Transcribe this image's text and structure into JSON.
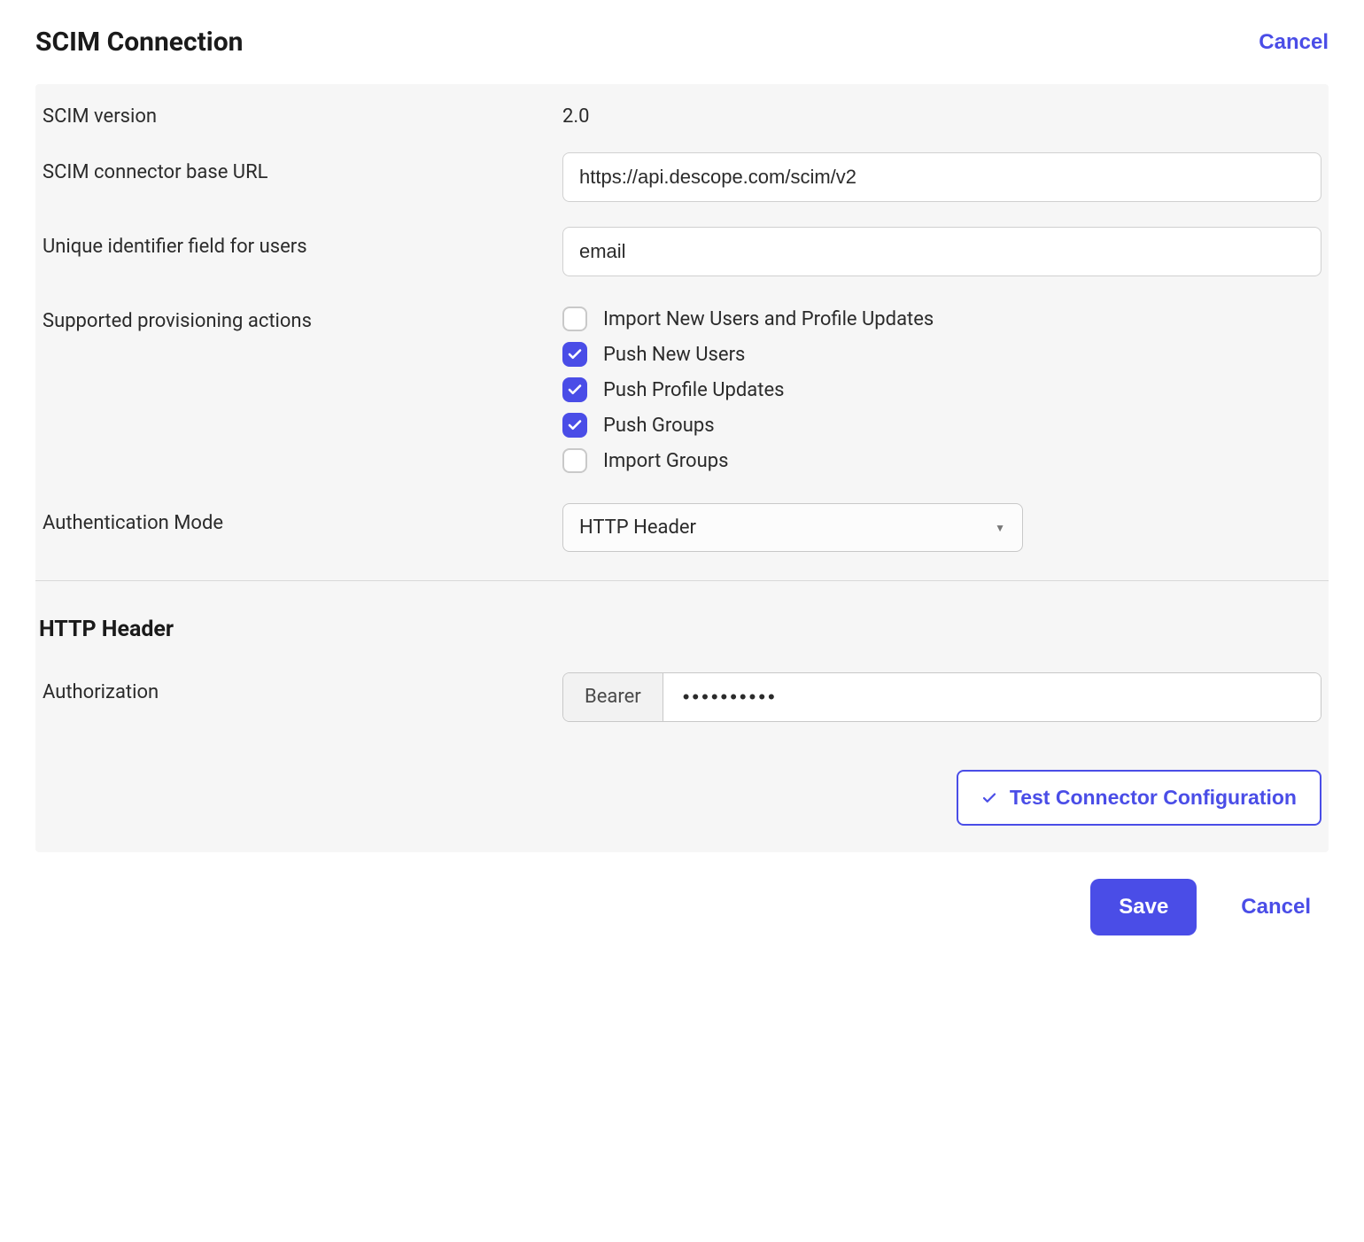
{
  "header": {
    "title": "SCIM Connection",
    "cancel": "Cancel"
  },
  "form": {
    "scim_version": {
      "label": "SCIM version",
      "value": "2.0"
    },
    "base_url": {
      "label": "SCIM connector base URL",
      "value": "https://api.descope.com/scim/v2"
    },
    "unique_id": {
      "label": "Unique identifier field for users",
      "value": "email"
    },
    "actions": {
      "label": "Supported provisioning actions",
      "items": [
        {
          "label": "Import New Users and Profile Updates",
          "checked": false
        },
        {
          "label": "Push New Users",
          "checked": true
        },
        {
          "label": "Push Profile Updates",
          "checked": true
        },
        {
          "label": "Push Groups",
          "checked": true
        },
        {
          "label": "Import Groups",
          "checked": false
        }
      ]
    },
    "auth_mode": {
      "label": "Authentication Mode",
      "value": "HTTP Header"
    }
  },
  "http_header": {
    "section_title": "HTTP Header",
    "authorization": {
      "label": "Authorization",
      "prefix": "Bearer",
      "value": "••••••••••"
    }
  },
  "buttons": {
    "test": "Test Connector Configuration",
    "save": "Save",
    "cancel": "Cancel"
  }
}
